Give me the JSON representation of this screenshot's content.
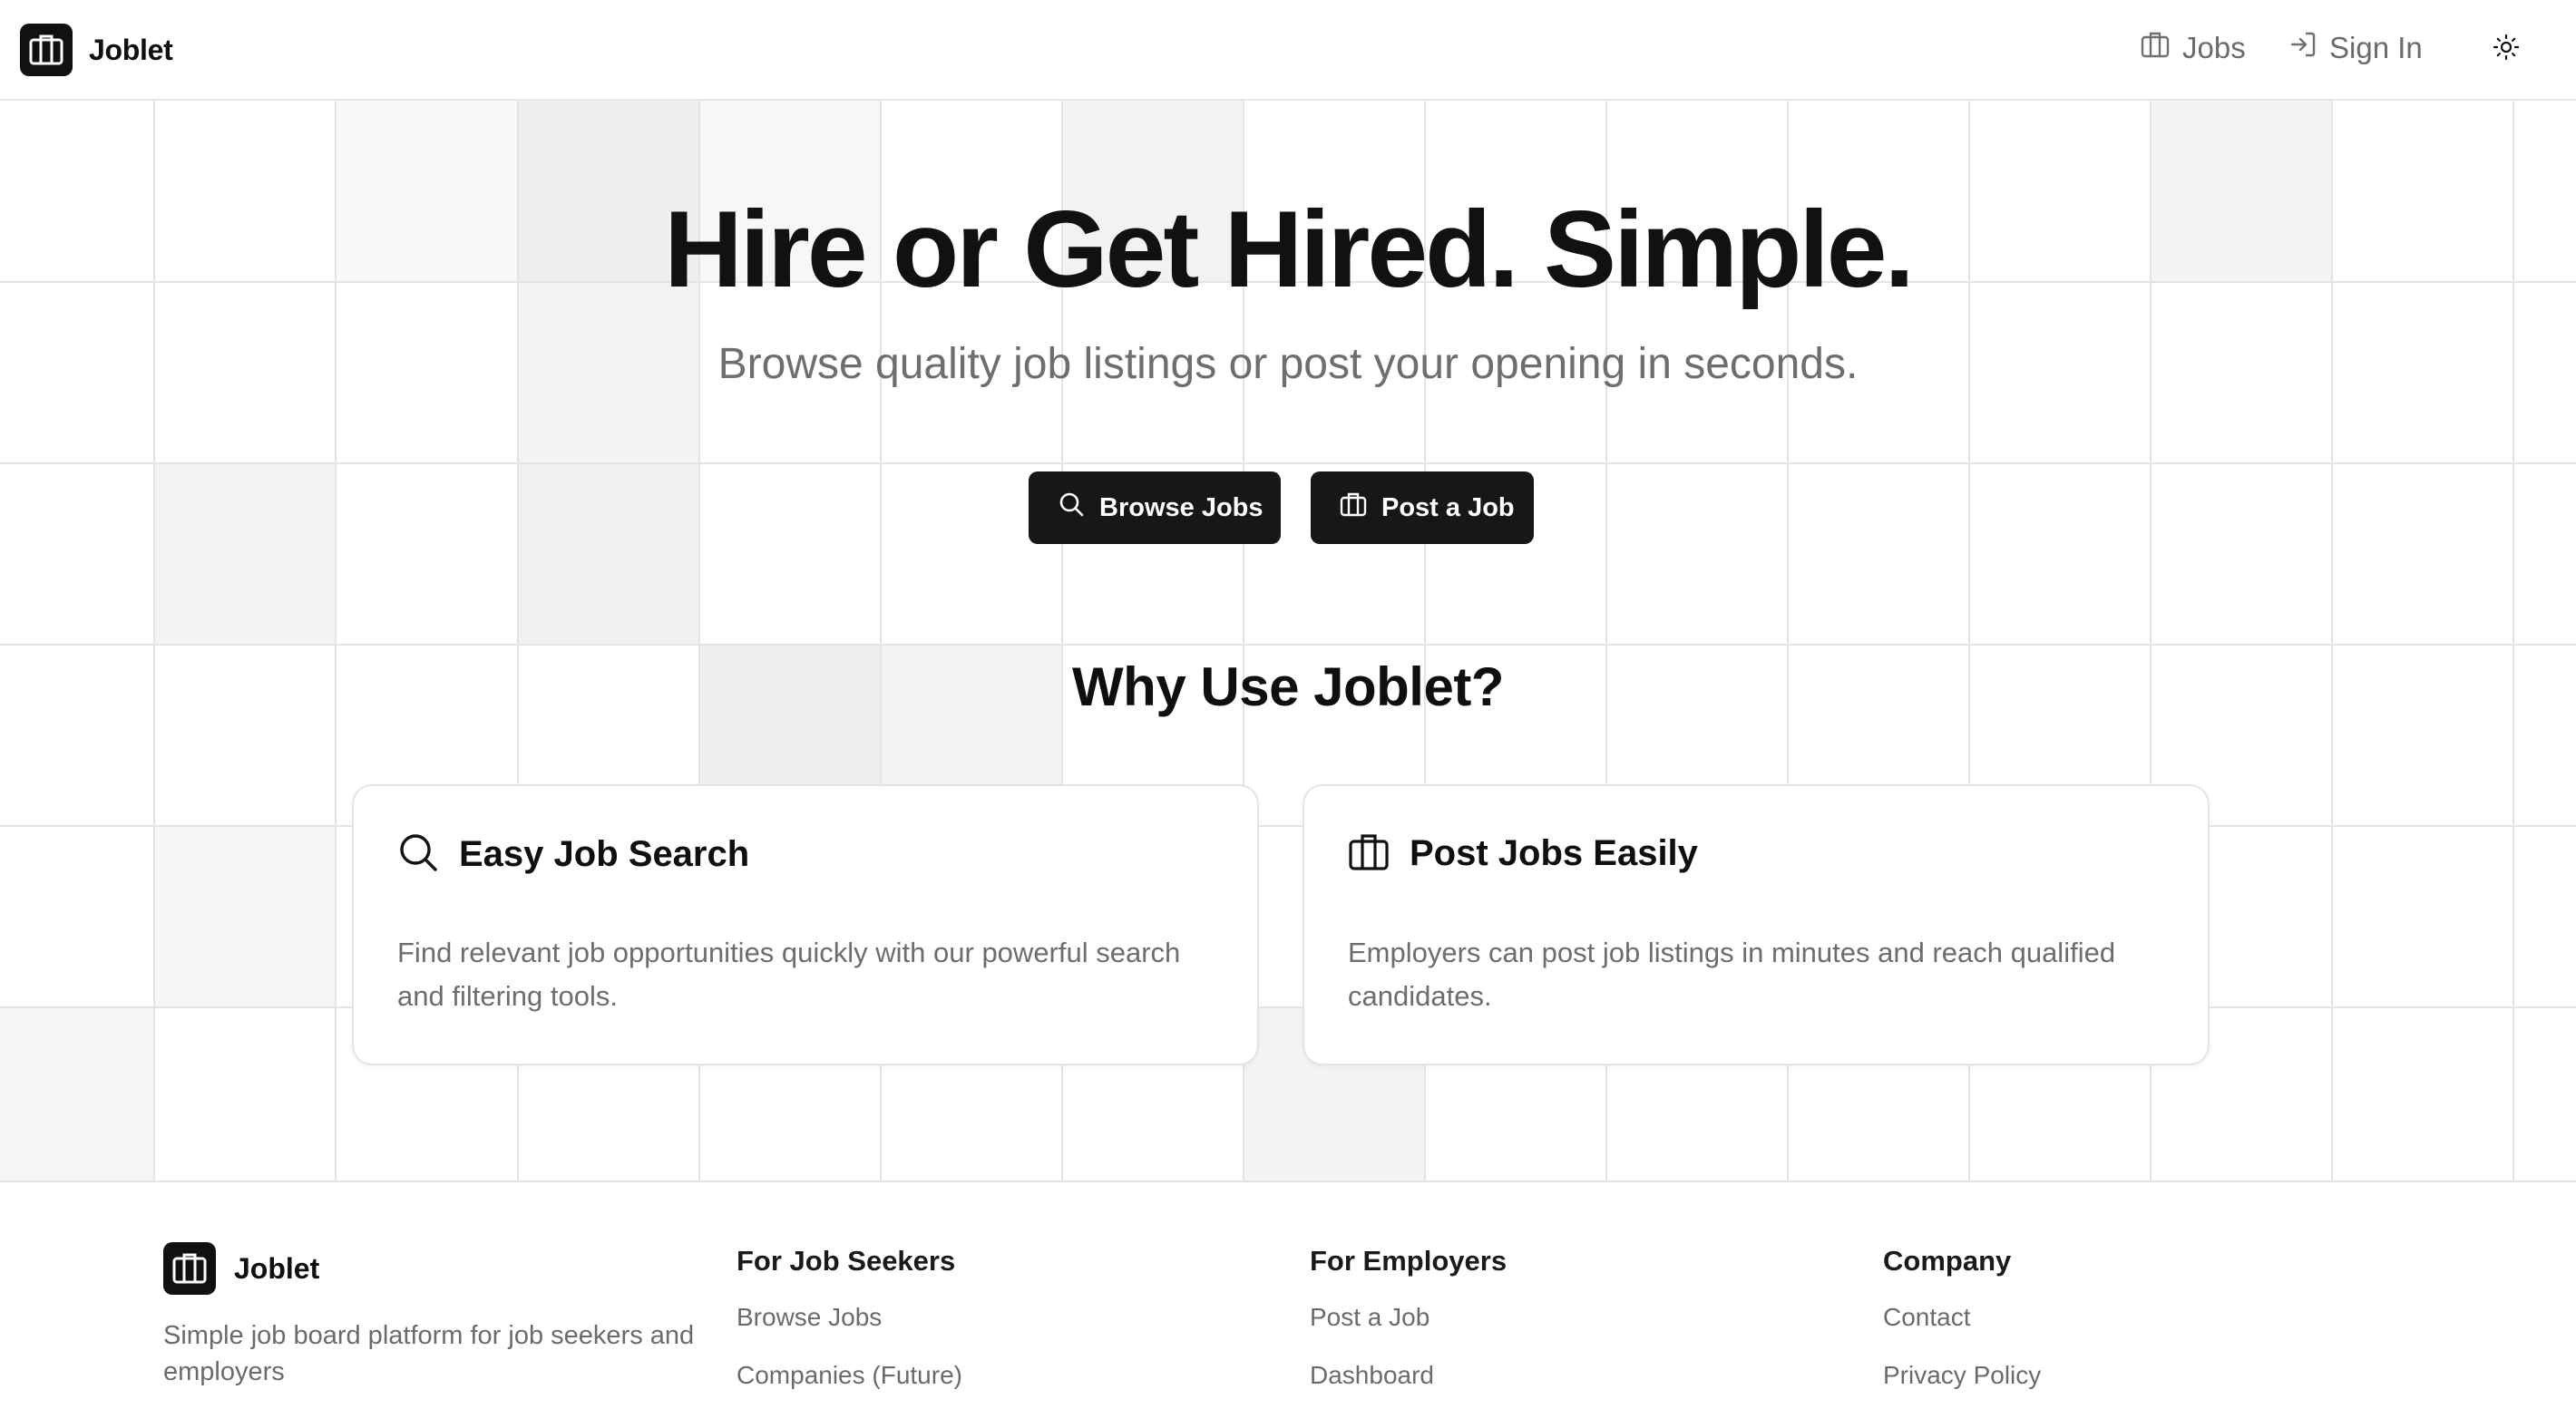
{
  "header": {
    "brand": "Joblet",
    "nav": {
      "jobs": "Jobs",
      "sign_in": "Sign In"
    }
  },
  "hero": {
    "title": "Hire or Get Hired. Simple.",
    "subtitle": "Browse quality job listings or post your opening in seconds.",
    "browse_label": "Browse Jobs",
    "post_label": "Post a Job"
  },
  "why": {
    "title": "Why Use Joblet?",
    "cards": [
      {
        "title": "Easy Job Search",
        "text": "Find relevant job opportunities quickly with our powerful search and filtering tools.",
        "icon": "search-icon"
      },
      {
        "title": "Post Jobs Easily",
        "text": "Employers can post job listings in minutes and reach qualified candidates.",
        "icon": "briefcase-icon"
      }
    ]
  },
  "footer": {
    "brand": "Joblet",
    "description": "Simple job board platform for job seekers and employers",
    "columns": [
      {
        "heading": "For Job Seekers",
        "links": [
          "Browse Jobs",
          "Companies (Future)"
        ]
      },
      {
        "heading": "For Employers",
        "links": [
          "Post a Job",
          "Dashboard"
        ]
      },
      {
        "heading": "Company",
        "links": [
          "Contact",
          "Privacy Policy"
        ]
      }
    ]
  },
  "colors": {
    "accent": "#171717",
    "muted_text": "#6e6e6e",
    "grid_line": "#e6e6e6",
    "cell_fill": "#f3f3f3"
  }
}
